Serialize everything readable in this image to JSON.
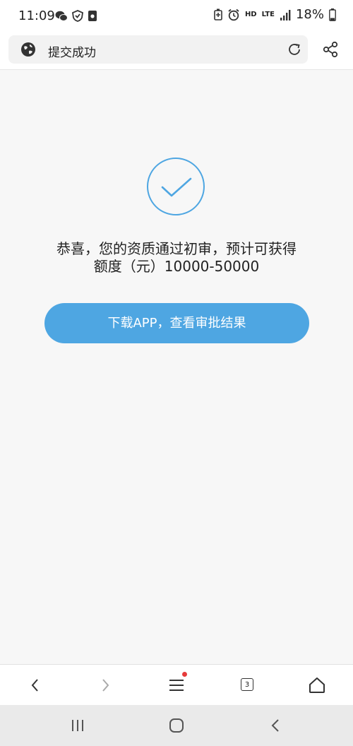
{
  "status_bar": {
    "time": "11:09",
    "network": "LTE",
    "hd": "HD",
    "battery": "18%"
  },
  "url_bar": {
    "title": "提交成功",
    "icons": [
      "globe-icon",
      "reload-icon",
      "share-icon"
    ]
  },
  "main": {
    "message_line1": "恭喜，您的资质通过初审，预计可获得",
    "message_line2": "额度（元）10000-50000",
    "button_label": "下载APP，查看审批结果",
    "accent_color": "#4ea6e2"
  },
  "toolbar": {
    "tabs_count": "3",
    "icons": [
      "back-icon",
      "forward-icon",
      "menu-icon",
      "tabs-icon",
      "home-icon"
    ]
  },
  "system_nav": {
    "icons": [
      "recents-icon",
      "home-circle-icon",
      "back-icon"
    ]
  }
}
